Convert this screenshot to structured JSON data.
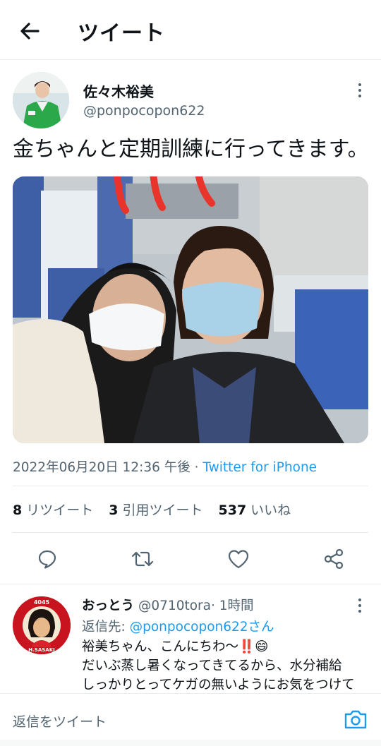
{
  "header": {
    "title": "ツイート",
    "back_icon": "arrow-left-icon"
  },
  "tweet": {
    "author_name": "佐々木裕美",
    "author_handle": "@ponpocopon622",
    "text": "金ちゃんと定期訓練に行ってきます。",
    "datetime": "2022年06月20日 12:36 午後",
    "separator": " · ",
    "source": "Twitter for iPhone",
    "retweets_count": "8",
    "retweets_label": "リツイート",
    "quotes_count": "3",
    "quotes_label": "引用ツイート",
    "likes_count": "537",
    "likes_label": "いいね"
  },
  "actions": [
    "reply-icon",
    "retweet-icon",
    "like-icon",
    "share-icon"
  ],
  "reply": {
    "name": "おっとう",
    "handle": "@0710tora",
    "time": "· 1時間",
    "reply_to_label": "返信先: ",
    "reply_to_mention": "@ponpocopon622さん",
    "line1": "裕美ちゃん、こんにちわ〜",
    "line1_marks": "‼️",
    "line1_emoji": "😄",
    "line2": "だいぶ蒸し暑くなってきてるから、水分補給",
    "line3": "しっかりとってケガの無いようにお気をつけて",
    "avatar_top_text": "4045",
    "avatar_bottom_text": "H.SASAKI"
  },
  "composer": {
    "placeholder": "返信をツイート",
    "camera_icon": "camera-icon"
  },
  "colors": {
    "accent": "#1d9bf0",
    "secondary_text": "#536471",
    "primary_text": "#0f1419",
    "divider": "#e6ecf0"
  }
}
